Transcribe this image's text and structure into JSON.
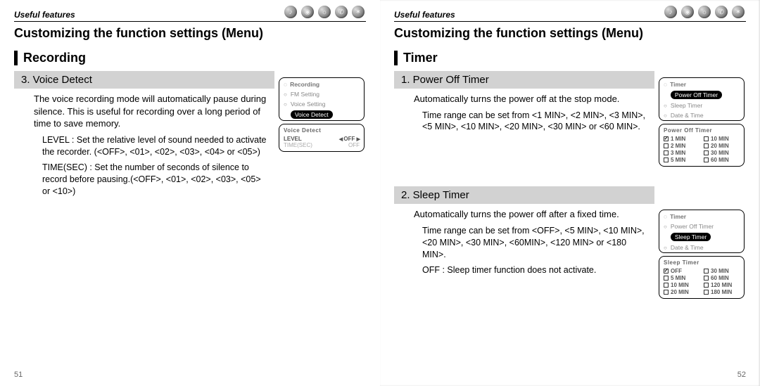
{
  "left": {
    "kicker": "Useful features",
    "title": "Customizing the function settings (Menu)",
    "section": "Recording",
    "item": {
      "num_title": "3. Voice Detect",
      "desc": "The voice recording mode will automatically pause during silence. This is useful for recording over a long period of time to save memory.",
      "level_line": "LEVEL : Set the relative level of sound needed to activate the recorder. (<OFF>, <01>, <02>, <03>, <04> or <05>)",
      "timesec_line": "TIME(SEC) : Set the number of seconds of silence to record before pausing.(<OFF>, <01>, <02>, <03>, <05> or <10>)"
    },
    "menu": {
      "header": "Recording",
      "rows": [
        "FM Setting",
        "Voice Setting",
        "Voice Detect"
      ],
      "selected_index": 2,
      "sub": {
        "title": "Voice Detect",
        "level_label": "LEVEL",
        "level_value": "OFF",
        "timesec_label": "TIME(SEC)",
        "timesec_value": "OFF"
      }
    },
    "page_num": "51"
  },
  "right": {
    "kicker": "Useful features",
    "title": "Customizing the function settings (Menu)",
    "section": "Timer",
    "item1": {
      "num_title": "1. Power Off Timer",
      "desc": "Automatically turns the power off at the stop mode.",
      "range": "Time range can be set from <1 MIN>, <2 MIN>, <3 MIN>, <5 MIN>, <10 MIN>, <20 MIN>, <30 MIN> or <60 MIN>."
    },
    "item2": {
      "num_title": "2. Sleep Timer",
      "desc": "Automatically turns the power off after a fixed time.",
      "range": "Time range can be set from <OFF>, <5 MIN>, <10 MIN>, <20 MIN>, <30 MIN>, <60MIN>, <120 MIN> or <180 MIN>.",
      "off_note": "OFF : Sleep timer function does not activate."
    },
    "menu1": {
      "header": "Timer",
      "rows": [
        "Power Off Timer",
        "Sleep Timer",
        "Date & Time"
      ],
      "selected_index": 0,
      "sub": {
        "title": "Power Off Timer",
        "options_left": [
          "1 MIN",
          "2 MIN",
          "3 MIN",
          "5 MIN"
        ],
        "options_right": [
          "10 MIN",
          "20 MIN",
          "30 MIN",
          "60 MIN"
        ],
        "checked_index": 0
      }
    },
    "menu2": {
      "header": "Timer",
      "rows": [
        "Power Off Timer",
        "Sleep Timer",
        "Date & Time"
      ],
      "selected_index": 1,
      "sub": {
        "title": "Sleep Timer",
        "options_left": [
          "OFF",
          "5 MIN",
          "10 MIN",
          "20 MIN"
        ],
        "options_right": [
          "30 MIN",
          "60 MIN",
          "120 MIN",
          "180 MIN"
        ],
        "checked_index": 0
      }
    },
    "page_num": "52"
  },
  "icons": [
    "music-icon",
    "spiral-icon",
    "globe-icon",
    "mic-icon",
    "gear-icon"
  ]
}
